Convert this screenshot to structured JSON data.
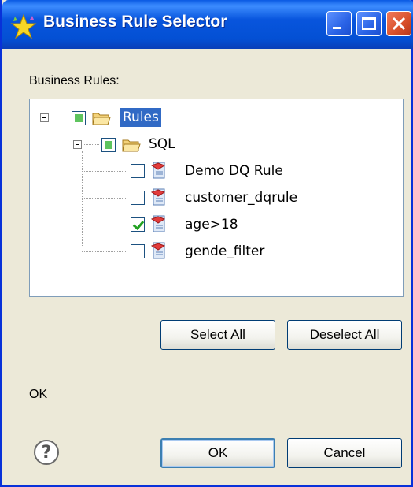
{
  "window": {
    "title": "Business Rule Selector",
    "title_icon": "wizard-star-icon",
    "controls": [
      "minimize-icon",
      "maximize-icon",
      "close-icon"
    ]
  },
  "tree_label": "Business Rules:",
  "tree": {
    "root": {
      "label": "Rules",
      "state": "partial",
      "expanded": true,
      "selected": true,
      "icon": "folder-open-icon"
    },
    "folder": {
      "label": "SQL",
      "state": "partial",
      "expanded": true,
      "icon": "folder-open-icon"
    },
    "rules": [
      {
        "label": "Demo DQ Rule",
        "checked": false,
        "icon": "rule-scroll-icon"
      },
      {
        "label": "customer_dqrule",
        "checked": false,
        "icon": "rule-scroll-icon"
      },
      {
        "label": "age>18",
        "checked": true,
        "icon": "rule-scroll-icon"
      },
      {
        "label": "gende_filter",
        "checked": false,
        "icon": "rule-scroll-icon"
      }
    ]
  },
  "buttons": {
    "select_all": "Select All",
    "deselect_all": "Deselect All",
    "ok": "OK",
    "cancel": "Cancel"
  },
  "status_text": "OK",
  "help_glyph": "?",
  "colors": {
    "titlebar": "#0855dd",
    "dialog_bg": "#ece9d8",
    "selection": "#316ac5",
    "check_green": "#21a121"
  }
}
